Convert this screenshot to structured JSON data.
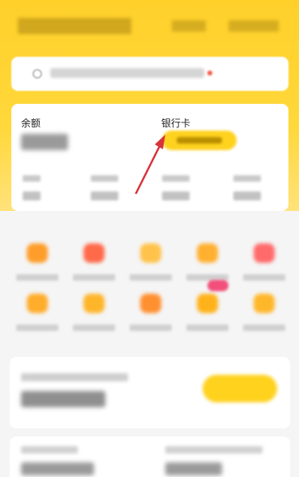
{
  "balance_card": {
    "balance_label": "余额",
    "bank_card_label": "银行卡"
  },
  "colors": {
    "brand_yellow": "#ffd21e",
    "header_bg": "#ffd83a",
    "arrow_red": "#d8333b",
    "badge_pink": "#f2507a"
  },
  "icons": [
    "search-icon",
    "arrow-annotation-icon"
  ]
}
